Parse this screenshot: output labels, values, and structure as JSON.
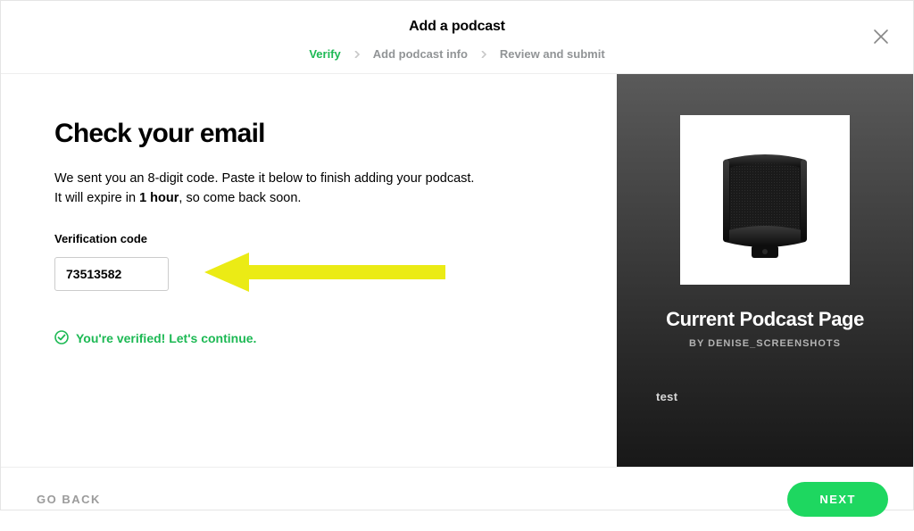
{
  "header": {
    "title": "Add a podcast",
    "steps": {
      "verify": "Verify",
      "info": "Add podcast info",
      "review": "Review and submit"
    }
  },
  "main": {
    "heading": "Check your email",
    "desc_part1": "We sent you an 8-digit code. Paste it below to finish adding your podcast.",
    "desc_part2a": "It will expire in ",
    "desc_bold": "1 hour",
    "desc_part2b": ", so come back soon.",
    "field_label": "Verification code",
    "code_value": "73513582",
    "success_text": "You're verified! Let's continue."
  },
  "preview": {
    "title": "Current Podcast Page",
    "author": "BY DENISE_SCREENSHOTS",
    "episode": "test"
  },
  "footer": {
    "back": "GO BACK",
    "next": "NEXT"
  },
  "colors": {
    "accent": "#1db954",
    "accent_bright": "#1ed760",
    "arrow": "#ebeb15"
  }
}
